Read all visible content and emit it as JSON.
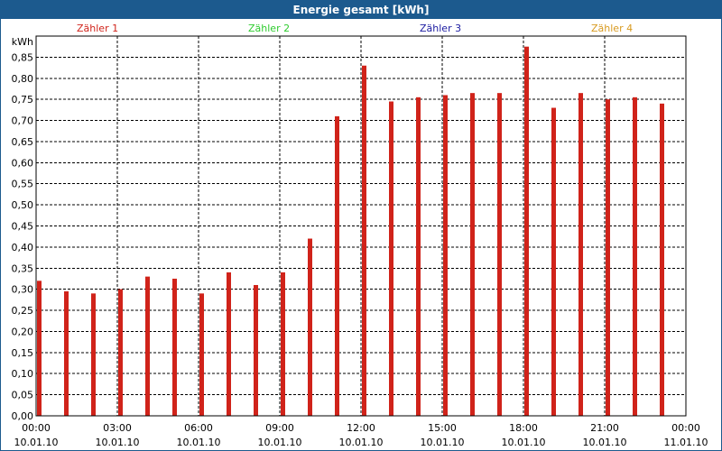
{
  "window": {
    "title": "Energie gesamt [kWh]"
  },
  "colors": {
    "titlebar": "#1c5a8e",
    "bar": "#d0231a",
    "grid": "#000000"
  },
  "legend": [
    {
      "label": "Zähler 1",
      "color": "#d0231a"
    },
    {
      "label": "Zähler 2",
      "color": "#2ecc2e"
    },
    {
      "label": "Zähler 3",
      "color": "#1a1aa0"
    },
    {
      "label": "Zähler 4",
      "color": "#d89a20"
    }
  ],
  "chart_data": {
    "type": "bar",
    "title": "Energie gesamt [kWh]",
    "ylabel": "kWh",
    "xlabel": "",
    "ylim": [
      0,
      0.9
    ],
    "yticks": [
      "0,00",
      "0,05",
      "0,10",
      "0,15",
      "0,20",
      "0,25",
      "0,30",
      "0,35",
      "0,40",
      "0,45",
      "0,50",
      "0,55",
      "0,60",
      "0,65",
      "0,70",
      "0,75",
      "0,80",
      "0,85"
    ],
    "xlim_hours": [
      0,
      24
    ],
    "xticks": [
      {
        "time": "00:00",
        "date": "10.01.10"
      },
      {
        "time": "03:00",
        "date": "10.01.10"
      },
      {
        "time": "06:00",
        "date": "10.01.10"
      },
      {
        "time": "09:00",
        "date": "10.01.10"
      },
      {
        "time": "12:00",
        "date": "10.01.10"
      },
      {
        "time": "15:00",
        "date": "10.01.10"
      },
      {
        "time": "18:00",
        "date": "10.01.10"
      },
      {
        "time": "21:00",
        "date": "10.01.10"
      },
      {
        "time": "00:00",
        "date": "11.01.10"
      }
    ],
    "grid": true,
    "series": [
      {
        "name": "Zähler 1",
        "x": [
          "00:00",
          "01:00",
          "02:00",
          "03:00",
          "04:00",
          "05:00",
          "06:00",
          "07:00",
          "08:00",
          "09:00",
          "10:00",
          "11:00",
          "12:00",
          "13:00",
          "14:00",
          "15:00",
          "16:00",
          "17:00",
          "18:00",
          "19:00",
          "20:00",
          "21:00",
          "22:00",
          "23:00"
        ],
        "values": [
          0.32,
          0.295,
          0.29,
          0.3,
          0.33,
          0.325,
          0.29,
          0.34,
          0.31,
          0.34,
          0.42,
          0.71,
          0.83,
          0.745,
          0.755,
          0.76,
          0.765,
          0.765,
          0.875,
          0.73,
          0.765,
          0.75,
          0.755,
          0.74
        ]
      }
    ]
  }
}
